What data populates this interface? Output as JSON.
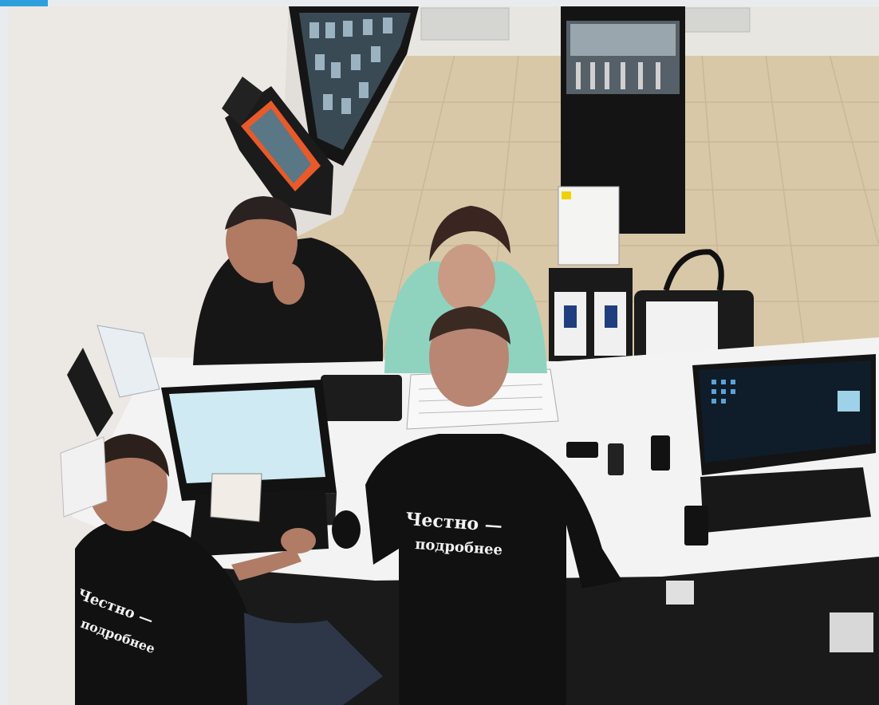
{
  "scene": {
    "type": "cctv-still",
    "colors": {
      "frame_background": "#e9ecef",
      "corner_accent": "#2f9fdc",
      "wall": "#ece9e4",
      "floor": "#d8c8a8",
      "counter": "#f3f3f3",
      "cabinet": "#1a1a1a",
      "shirt": "#111111",
      "jacket_green": "#8fd3bf",
      "monitor_screen": "#cfeaf2"
    },
    "employee_center": {
      "shirt_line1": "Честно —",
      "shirt_line2": "подробнее"
    },
    "employee_left": {
      "shirt_line1": "Честно —",
      "shirt_line2": "подробнее"
    }
  }
}
